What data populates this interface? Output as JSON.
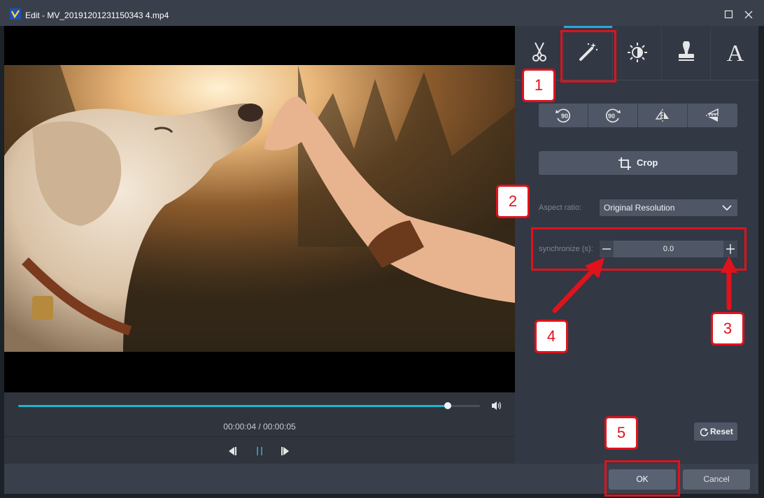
{
  "window": {
    "title": "Edit - MV_20191201231150343 4.mp4"
  },
  "player": {
    "time": "00:00:04 / 00:00:05",
    "progress_fraction": 0.93
  },
  "sidebar": {
    "tabs": [
      {
        "name": "cut-tab",
        "icon": "scissors-icon"
      },
      {
        "name": "effect-tab",
        "icon": "magic-wand-icon"
      },
      {
        "name": "adjust-tab",
        "icon": "brightness-icon"
      },
      {
        "name": "watermark-tab",
        "icon": "stamp-icon"
      },
      {
        "name": "text-tab",
        "icon": "text-icon"
      }
    ],
    "rotate_buttons": [
      {
        "label": "90",
        "icon": "rotate-left-icon"
      },
      {
        "label": "90",
        "icon": "rotate-right-icon"
      },
      {
        "icon": "flip-horizontal-icon"
      },
      {
        "icon": "flip-vertical-icon"
      }
    ],
    "crop_label": "Crop",
    "aspect_label": "Aspect ratio:",
    "aspect_value": "Original Resolution",
    "sync_label": "synchronize (s):",
    "sync_value": "0.0",
    "reset_label": "Reset"
  },
  "footer": {
    "ok_label": "OK",
    "cancel_label": "Cancel"
  },
  "annotations": [
    "1",
    "2",
    "3",
    "4",
    "5"
  ],
  "colors": {
    "annotation": "#e0121c",
    "progress": "#1fb6c8",
    "active_tab": "#2ea6d9"
  }
}
